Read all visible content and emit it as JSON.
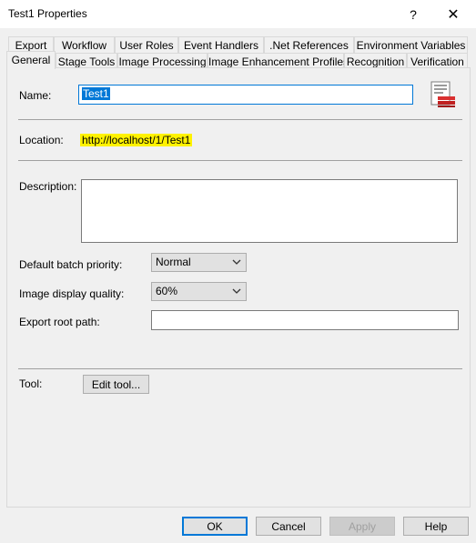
{
  "window": {
    "title": "Test1 Properties",
    "help": "?",
    "close": "✕"
  },
  "tabs_row1": [
    "Export",
    "Workflow",
    "User Roles",
    "Event Handlers",
    ".Net References",
    "Environment Variables"
  ],
  "tabs_row2": [
    "General",
    "Stage Tools",
    "Image Processing",
    "Image Enhancement Profiles",
    "Recognition",
    "Verification"
  ],
  "general": {
    "name_label": "Name:",
    "name_value": "Test1",
    "location_label": "Location:",
    "location_value": "http://localhost/1/Test1",
    "description_label": "Description:",
    "description_value": "",
    "priority_label": "Default batch priority:",
    "priority_value": "Normal",
    "quality_label": "Image display quality:",
    "quality_value": "60%",
    "export_label": "Export root path:",
    "export_value": "",
    "tool_label": "Tool:",
    "edit_tool": "Edit tool..."
  },
  "buttons": {
    "ok": "OK",
    "cancel": "Cancel",
    "apply": "Apply",
    "help": "Help"
  },
  "colors": {
    "accent": "#0078d7",
    "highlight": "#fff200"
  }
}
